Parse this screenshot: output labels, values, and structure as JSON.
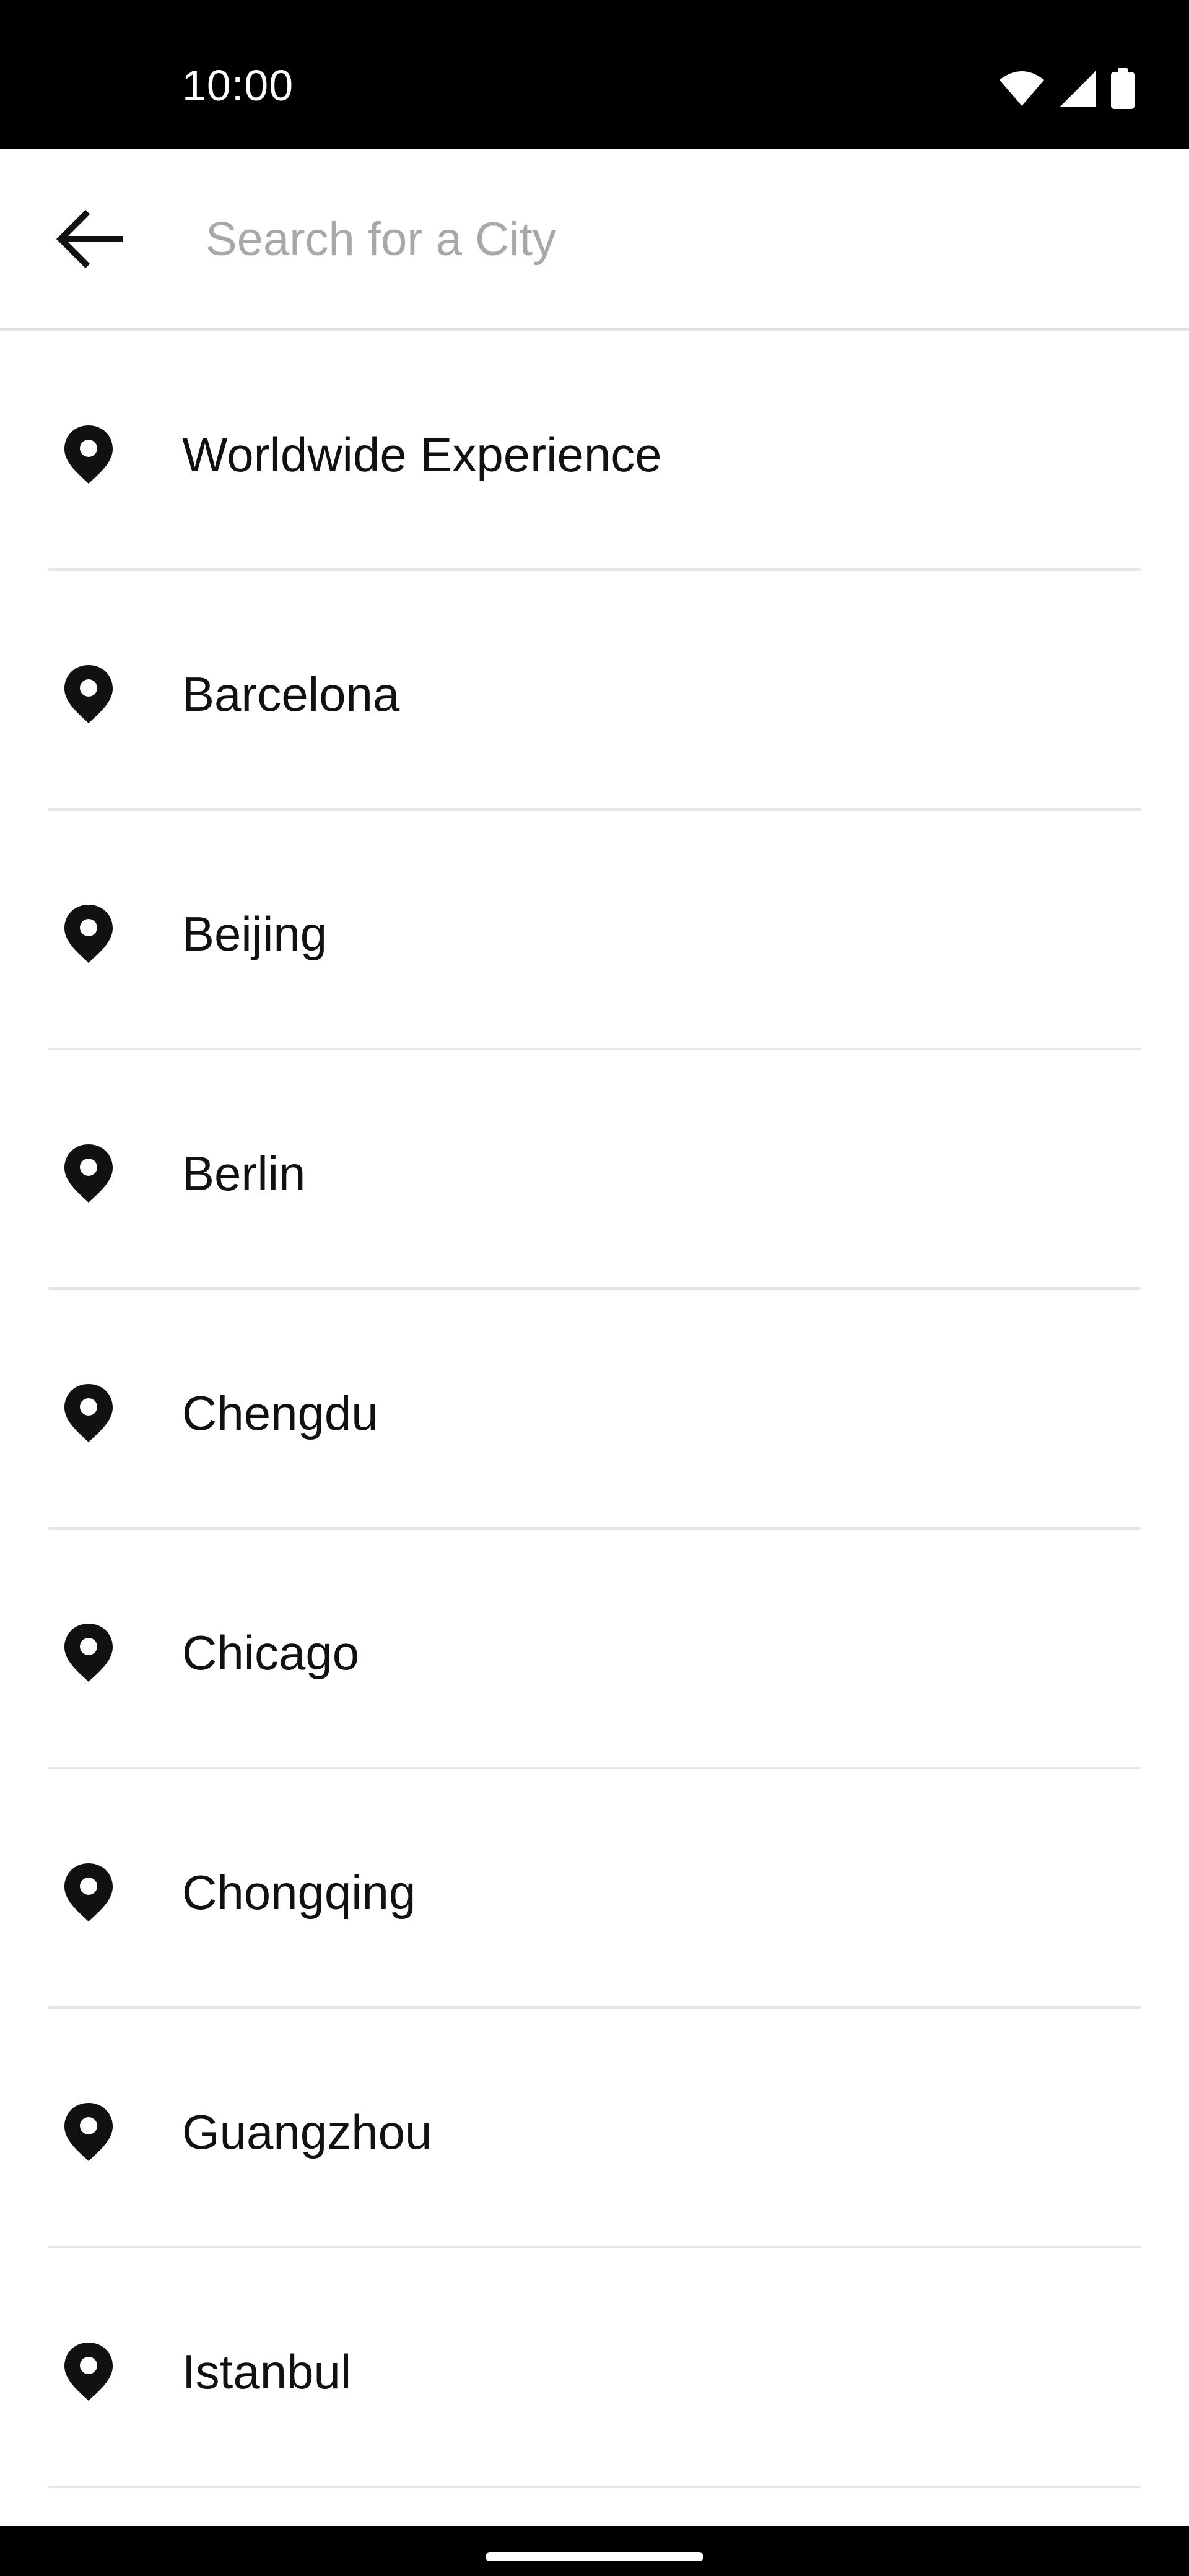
{
  "status_bar": {
    "time": "10:00",
    "icons": [
      "wifi-icon",
      "cellular-signal-icon",
      "battery-icon"
    ]
  },
  "app_bar": {
    "back_icon": "arrow-left-icon",
    "search": {
      "placeholder": "Search for a City",
      "value": ""
    }
  },
  "cities": {
    "icon": "location-pin-icon",
    "items": [
      {
        "label": "Worldwide Experience"
      },
      {
        "label": "Barcelona"
      },
      {
        "label": "Beijing"
      },
      {
        "label": "Berlin"
      },
      {
        "label": "Chengdu"
      },
      {
        "label": "Chicago"
      },
      {
        "label": "Chongqing"
      },
      {
        "label": "Guangzhou"
      },
      {
        "label": "Istanbul"
      }
    ]
  },
  "colors": {
    "background": "#ffffff",
    "text": "#111111",
    "placeholder": "#a8a8a8",
    "divider": "#e6e6e6",
    "system_bars": "#000000"
  }
}
